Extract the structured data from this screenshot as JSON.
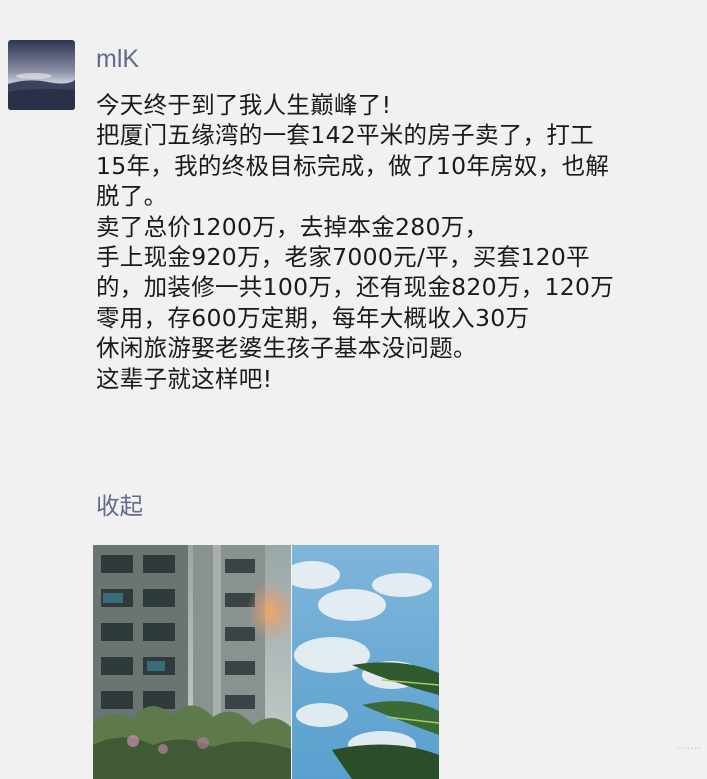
{
  "post": {
    "author": "mlK",
    "avatar_icon": "sea-landscape-avatar-icon",
    "text_lines": [
      "今天终于到了我人生巅峰了!",
      "把厦门五缘湾的一套142平米的房子卖了，打工",
      "15年，我的终极目标完成，做了10年房奴，也解",
      "脱了。",
      "卖了总价1200万，去掉本金280万，",
      "手上现金920万，老家7000元/平，买套120平",
      "的，加装修一共100万，还有现金820万，120万",
      "零用，存600万定期，每年大概收入30万",
      "休闲旅游娶老婆生孩子基本没问题。",
      "这辈子就这样吧!"
    ],
    "collapse_label": "收起",
    "images": [
      {
        "icon": "apartment-building-photo"
      },
      {
        "icon": "sky-clouds-photo"
      }
    ]
  },
  "colors": {
    "background": "#f1f1f1",
    "text": "#1a1a1a",
    "link": "#5f6c8c"
  }
}
